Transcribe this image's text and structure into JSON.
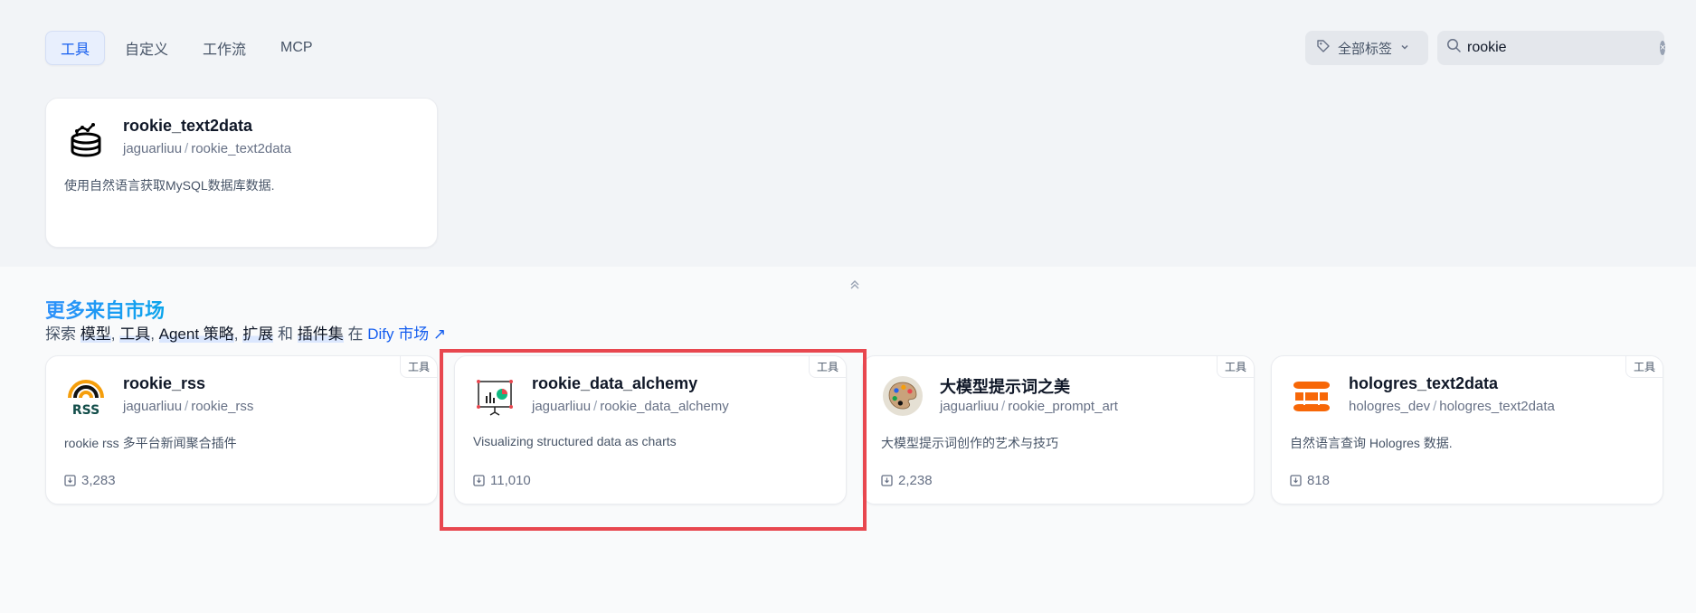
{
  "tabs": [
    {
      "label": "工具",
      "active": true
    },
    {
      "label": "自定义",
      "active": false
    },
    {
      "label": "工作流",
      "active": false
    },
    {
      "label": "MCP",
      "active": false
    }
  ],
  "tag_filter": {
    "label": "全部标签",
    "icon": "tag-icon"
  },
  "search": {
    "value": "rookie",
    "icon": "search-icon"
  },
  "installed_card": {
    "title": "rookie_text2data",
    "author": "jaguarliuu",
    "name": "rookie_text2data",
    "description": "使用自然语言获取MySQL数据库数据.",
    "icon": "database-icon"
  },
  "market": {
    "title": "更多来自市场",
    "subtitle_prefix": "探索",
    "items": [
      "模型",
      "工具",
      "Agent 策略",
      "扩展"
    ],
    "conjunction": "和",
    "last_item": "插件集",
    "in_text": "在",
    "link_label": "Dify 市场"
  },
  "market_cards": [
    {
      "tag": "工具",
      "title": "rookie_rss",
      "author": "jaguarliuu",
      "name": "rookie_rss",
      "description": "rookie rss 多平台新闻聚合插件",
      "downloads": "3,283",
      "icon": "rss-icon"
    },
    {
      "tag": "工具",
      "title": "rookie_data_alchemy",
      "author": "jaguarliuu",
      "name": "rookie_data_alchemy",
      "description": "Visualizing structured data as charts",
      "downloads": "11,010",
      "icon": "chart-board-icon"
    },
    {
      "tag": "工具",
      "title": "大模型提示词之美",
      "author": "jaguarliuu",
      "name": "rookie_prompt_art",
      "description": "大模型提示词创作的艺术与技巧",
      "downloads": "2,238",
      "icon": "palette-icon"
    },
    {
      "tag": "工具",
      "title": "hologres_text2data",
      "author": "hologres_dev",
      "name": "hologres_text2data",
      "description": "自然语言查询 Hologres 数据.",
      "downloads": "818",
      "icon": "hologres-icon"
    }
  ],
  "colors": {
    "accent": "#155eef",
    "highlight_border": "#e8474f",
    "hologres_orange": "#f76707"
  }
}
